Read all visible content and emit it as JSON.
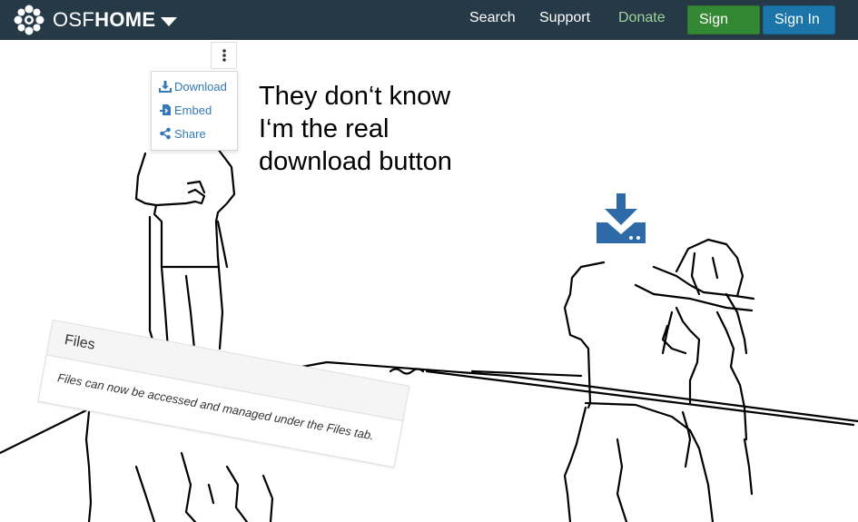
{
  "navbar": {
    "brand_light": "OSF",
    "brand_bold": "HOME",
    "links": {
      "search": "Search",
      "support": "Support",
      "donate": "Donate"
    },
    "buttons": {
      "sign_up": "Sign Up",
      "sign_in": "Sign In"
    },
    "colors": {
      "bar": "#263947",
      "sign_up": "#338833",
      "sign_in": "#1b75a8",
      "donate": "#9ed39c"
    }
  },
  "menu": {
    "items": [
      {
        "label": "Download",
        "icon": "download-icon"
      },
      {
        "label": "Embed",
        "icon": "embed-icon"
      },
      {
        "label": "Share",
        "icon": "share-icon"
      }
    ]
  },
  "caption": {
    "line1": "They don‘t know",
    "line2": "I‘m the real",
    "line3": "download button"
  },
  "files_panel": {
    "heading": "Files",
    "message": "Files can now be accessed and managed under the Files tab."
  },
  "icons": {
    "big_download": "download-icon",
    "kebab": "vertical-ellipsis-icon"
  },
  "accent": "#337ab7"
}
